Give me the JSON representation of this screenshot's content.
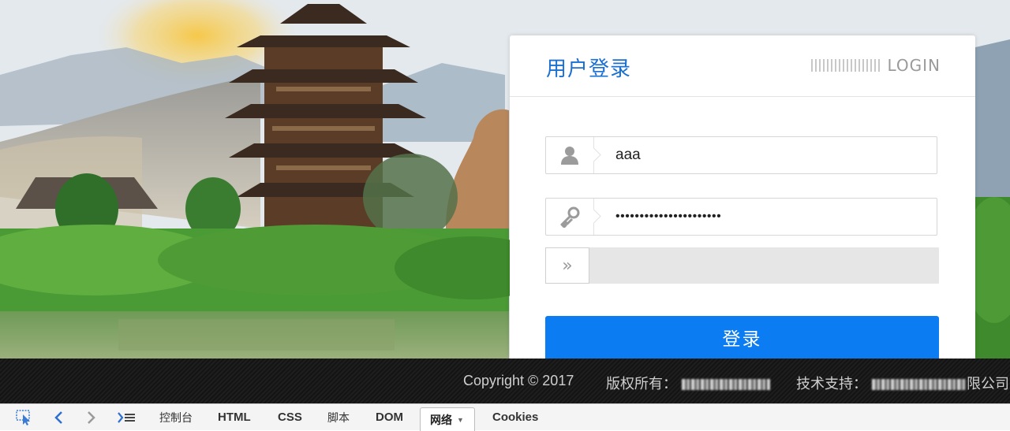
{
  "login": {
    "title": "用户登录",
    "mark": "LOGIN",
    "username_value": "aaa",
    "password_value": "••••••••••••••••••••••",
    "slider_handle": "»",
    "submit_label": "登录",
    "accent_color": "#0b7cf2"
  },
  "footer": {
    "copyright": "Copyright © 2017",
    "owner_label": "版权所有：",
    "support_label": "技术支持：",
    "support_tail": "限公司"
  },
  "devtools": {
    "tabs": [
      "控制台",
      "HTML",
      "CSS",
      "脚本",
      "DOM",
      "网络",
      "Cookies"
    ],
    "active_tab": "网络"
  },
  "icons": [
    "inspect-icon",
    "back-icon",
    "forward-icon",
    "command-line-icon",
    "user-icon",
    "key-icon",
    "double-chevron-icon",
    "dropdown-caret-icon"
  ]
}
